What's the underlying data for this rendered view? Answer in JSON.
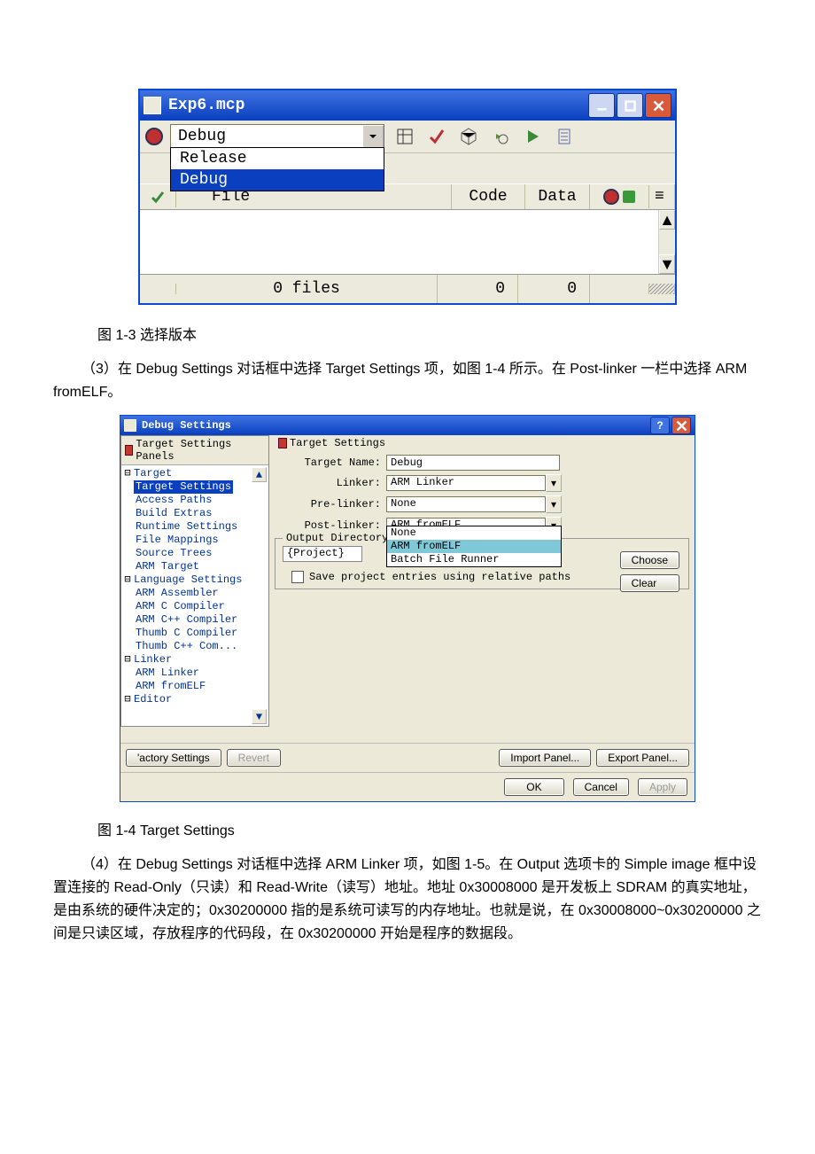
{
  "fig13": {
    "window_title": "Exp6.mcp",
    "select_value": "Debug",
    "select_options": [
      "Release",
      "Debug"
    ],
    "columns": {
      "file": "File",
      "code": "Code",
      "data": "Data"
    },
    "footer": {
      "files": "0 files",
      "code": "0",
      "data": "0"
    }
  },
  "caption13": "图 1-3 选择版本",
  "para3": "（3）在 Debug Settings 对话框中选择 Target Settings 项，如图 1-4 所示。在 Post-linker 一栏中选择 ARM fromELF。",
  "fig14": {
    "window_title": "Debug Settings",
    "left_panel_title": "Target Settings Panels",
    "right_panel_title": "Target Settings",
    "tree": {
      "target": "Target",
      "target_items": [
        "Target Settings",
        "Access Paths",
        "Build Extras",
        "Runtime Settings",
        "File Mappings",
        "Source Trees",
        "ARM Target"
      ],
      "language": "Language Settings",
      "language_items": [
        "ARM Assembler",
        "ARM C Compiler",
        "ARM C++ Compiler",
        "Thumb C Compiler",
        "Thumb C++ Com..."
      ],
      "linker": "Linker",
      "linker_items": [
        "ARM Linker",
        "ARM fromELF"
      ],
      "editor": "Editor"
    },
    "form": {
      "target_name_label": "Target Name:",
      "target_name_value": "Debug",
      "linker_label": "Linker:",
      "linker_value": "ARM Linker",
      "pre_label": "Pre-linker:",
      "pre_value": "None",
      "post_label": "Post-linker:",
      "post_value": "ARM fromELF",
      "post_options": [
        "None",
        "ARM fromELF",
        "Batch File Runner"
      ],
      "outdir_label": "Output Directory:",
      "outdir_value": "{Project}",
      "choose": "Choose",
      "clear": "Clear",
      "save_paths": "Save project entries using relative paths"
    },
    "buttons1": {
      "factory": "'actory Settings",
      "revert": "Revert",
      "import": "Import Panel...",
      "export": "Export Panel..."
    },
    "buttons2": {
      "ok": "OK",
      "cancel": "Cancel",
      "apply": "Apply"
    }
  },
  "caption14": "图 1-4 Target Settings",
  "para4": "（4）在 Debug Settings 对话框中选择 ARM Linker 项，如图 1-5。在 Output 选项卡的 Simple image 框中设置连接的 Read-Only（只读）和 Read-Write（读写）地址。地址 0x30008000 是开发板上 SDRAM 的真实地址，是由系统的硬件决定的；0x30200000 指的是系统可读写的内存地址。也就是说，在 0x30008000~0x30200000 之间是只读区域，存放程序的代码段，在 0x30200000 开始是程序的数据段。"
}
